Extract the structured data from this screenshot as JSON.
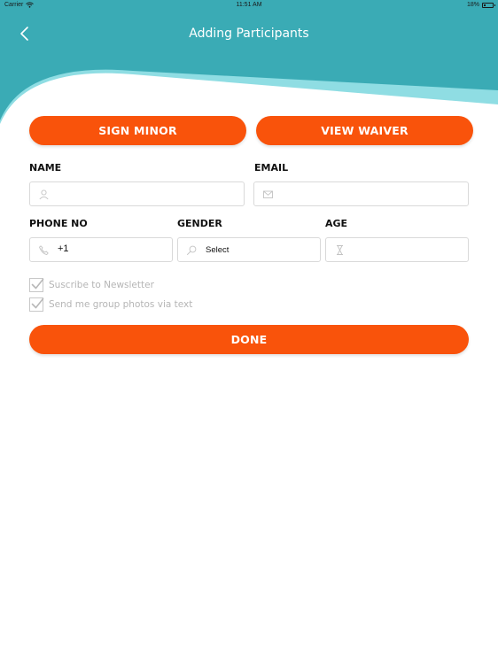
{
  "status_bar": {
    "carrier": "Carrier",
    "time": "11:51 AM",
    "battery": "18%"
  },
  "header": {
    "title": "Adding Participants"
  },
  "actions": {
    "sign_minor": "SIGN MINOR",
    "view_waiver": "VIEW WAIVER"
  },
  "form": {
    "name": {
      "label": "NAME",
      "value": "",
      "icon": "user-icon"
    },
    "email": {
      "label": "EMAIL",
      "value": "",
      "icon": "mail-icon"
    },
    "phone": {
      "label": "PHONE NO",
      "value": "+1",
      "icon": "phone-icon"
    },
    "gender": {
      "label": "GENDER",
      "value": "Select",
      "icon": "search-icon"
    },
    "age": {
      "label": "AGE",
      "value": "",
      "icon": "hourglass-icon"
    }
  },
  "options": {
    "newsletter": {
      "label": "Suscribe to Newsletter",
      "checked": true
    },
    "group_photos": {
      "label": "Send me group photos via text",
      "checked": true
    }
  },
  "done_label": "DONE",
  "colors": {
    "teal": "#3aabb5",
    "teal_light": "#7fd3da",
    "accent": "#f9530b"
  }
}
